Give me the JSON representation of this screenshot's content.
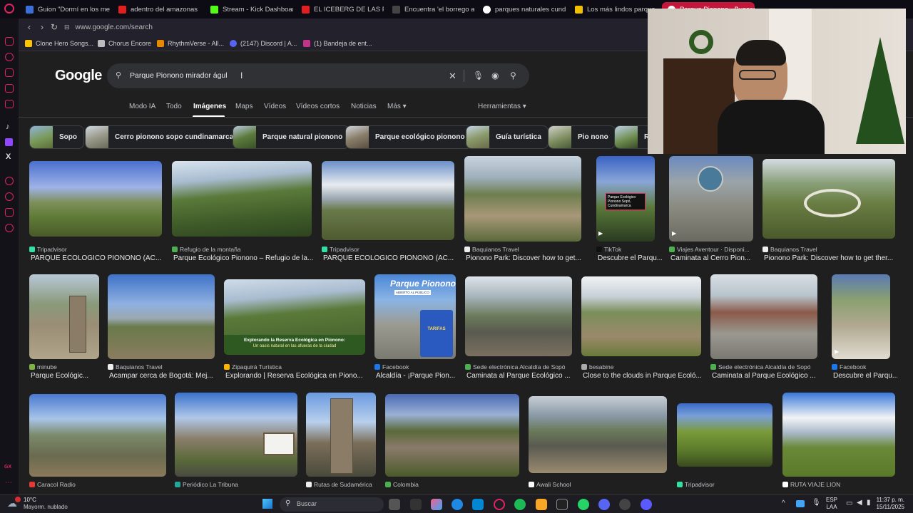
{
  "tabs": [
    {
      "title": "Guion \"Dormí en los mejo",
      "color": "#3b6fd8"
    },
    {
      "title": "adentro del amazonas - Y",
      "color": "#e02020"
    },
    {
      "title": "Stream - Kick Dashboard",
      "color": "#53fc18"
    },
    {
      "title": "EL ICEBERG DE LAS PELÍ",
      "color": "#e02020"
    },
    {
      "title": "Encuentra 'el borrego am",
      "color": "#2a2a2a"
    },
    {
      "title": "parques naturales cundin",
      "color": "#ffffff"
    },
    {
      "title": "Los más lindos parque",
      "color": "#f0c000"
    },
    {
      "title": "Parque Pionono - Buscar",
      "color": "#ffffff"
    }
  ],
  "url": "www.google.com/search",
  "bookmarks": [
    {
      "label": "Clone Hero Songs...",
      "color": "#f7c600"
    },
    {
      "label": "Chorus Encore",
      "color": "#bbbbbb"
    },
    {
      "label": "RhythmVerse - All...",
      "color": "#e58a00"
    },
    {
      "label": "(2147) Discord | A...",
      "color": "#5865f2"
    },
    {
      "label": "(1) Bandeja de ent...",
      "color": "#c1348a"
    }
  ],
  "google": {
    "logo": "Google",
    "query": "Parque Pionono mirador águl",
    "filters": [
      "Modo IA",
      "Todo",
      "Imágenes",
      "Maps",
      "Vídeos",
      "Vídeos cortos",
      "Noticias",
      "Más ▾"
    ],
    "tools": "Herramientas ▾",
    "chips": [
      "Sopo",
      "Cerro pionono sopo cundinamarca",
      "Parque natural pionono",
      "Parque ecológico pionono",
      "Guía turística",
      "Pio nono",
      "R"
    ]
  },
  "results": [
    {
      "source": "Tripadvisor",
      "title": "PARQUE ECOLOGICO PIONONO (AC...",
      "fav": "#34e0a1"
    },
    {
      "source": "Refugio de la montaña",
      "title": "Parque Ecológico Pionono – Refugio de la...",
      "fav": "#4caf50"
    },
    {
      "source": "Tripadvisor",
      "title": "PARQUE ECOLOGICO PIONONO (AC...",
      "fav": "#34e0a1"
    },
    {
      "source": "Baquianos Travel",
      "title": "Pionono Park: Discover how to get...",
      "fav": "#eeeeee"
    },
    {
      "source": "TikTok",
      "title": "Descubre el Parqu...",
      "fav": "#111111"
    },
    {
      "source": "Viajes Aventour · Disponi...",
      "title": "Caminata al Cerro Pion...",
      "fav": "#4caf50"
    },
    {
      "source": "Baquianos Travel",
      "title": "Pionono Park: Discover how to get ther...",
      "fav": "#eeeeee"
    },
    {
      "source": "minube",
      "title": "Parque Ecológic...",
      "fav": "#7cb342"
    },
    {
      "source": "Baquianos Travel",
      "title": "Acampar cerca de Bogotá: Mej...",
      "fav": "#eeeeee"
    },
    {
      "source": "Zipaquirá Turística",
      "title": "Explorando | Reserva Ecológica en Piono...",
      "fav": "#ffb300"
    },
    {
      "source": "Facebook",
      "title": "Alcaldía - ¡Parque Pion...",
      "fav": "#1877f2"
    },
    {
      "source": "Sede electrónica Alcaldía de Sopó",
      "title": "Caminata al Parque Ecológico ...",
      "fav": "#4caf50"
    },
    {
      "source": "besabine",
      "title": "Close to the clouds in Parque Ecoló...",
      "fav": "#aaaaaa"
    },
    {
      "source": "Sede electrónica Alcaldía de Sopó",
      "title": "Caminata al Parque Ecológico ...",
      "fav": "#4caf50"
    },
    {
      "source": "Facebook",
      "title": "Descubre el Parqu...",
      "fav": "#1877f2"
    },
    {
      "source": "Caracol Radio",
      "title": "",
      "fav": "#e53935"
    },
    {
      "source": "Periódico La Tribuna",
      "title": "",
      "fav": "#26a69a"
    },
    {
      "source": "Rutas de Sudamérica",
      "title": "",
      "fav": "#eeeeee"
    },
    {
      "source": "Colombia",
      "title": "",
      "fav": "#4caf50"
    },
    {
      "source": "Awali School",
      "title": "",
      "fav": "#ffffff"
    },
    {
      "source": "Tripadvisor",
      "title": "",
      "fav": "#34e0a1"
    },
    {
      "source": "RUTA VIAJE LION",
      "title": "",
      "fav": "#ffffff"
    }
  ],
  "overlay_texts": {
    "promo_1": "Parque Ecológico Pionono Sopó, Cundinamarca",
    "promo_2": "Explorando la Reserva Ecológica en Pionono:",
    "promo_3": "Un oasis natural en las afueras de la ciudad",
    "poster_title": "Parque Pionono",
    "poster_sub": "ABIERTO AL PÚBLICO",
    "poster_tarifas": "TARIFAS"
  },
  "taskbar": {
    "weather_temp": "10°C",
    "weather_desc": "Mayorm. nublado",
    "search_placeholder": "Buscar",
    "lang_line1": "ESP",
    "lang_line2": "LAA",
    "time": "11:37 p. m.",
    "date": "15/11/2025"
  }
}
